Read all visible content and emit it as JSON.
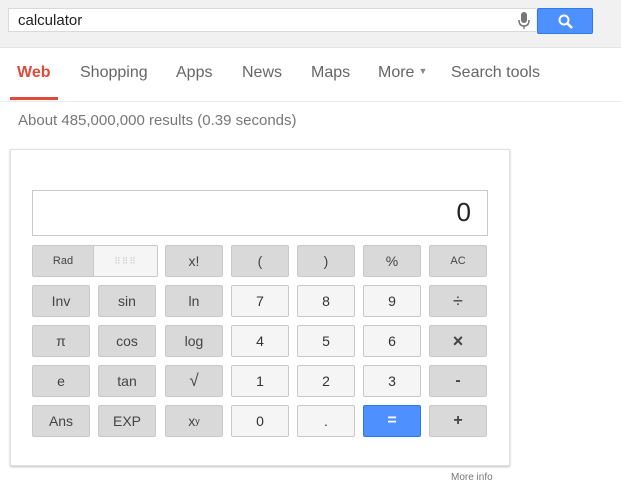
{
  "search": {
    "query": "calculator"
  },
  "tabs": [
    "Web",
    "Shopping",
    "Apps",
    "News",
    "Maps",
    "More",
    "Search tools"
  ],
  "results_text": "About 485,000,000 results (0.39 seconds)",
  "calculator": {
    "display": "0",
    "keys": {
      "rad": "Rad",
      "deg": "Deg",
      "fact": "x!",
      "lparen": "(",
      "rparen": ")",
      "percent": "%",
      "ac": "AC",
      "inv": "Inv",
      "sin": "sin",
      "ln": "ln",
      "seven": "7",
      "eight": "8",
      "nine": "9",
      "divide": "÷",
      "pi": "π",
      "cos": "cos",
      "log": "log",
      "four": "4",
      "five": "5",
      "six": "6",
      "multiply": "×",
      "e": "e",
      "tan": "tan",
      "sqrt": "√",
      "one": "1",
      "two": "2",
      "three": "3",
      "minus": "-",
      "ans": "Ans",
      "exp": "EXP",
      "pow_base": "x",
      "pow_exp": "y",
      "zero": "0",
      "dot": ".",
      "equals": "=",
      "plus": "+"
    }
  },
  "more_info": "More info",
  "colors": {
    "accent": "#dd4b39",
    "blue": "#4d90fe"
  }
}
